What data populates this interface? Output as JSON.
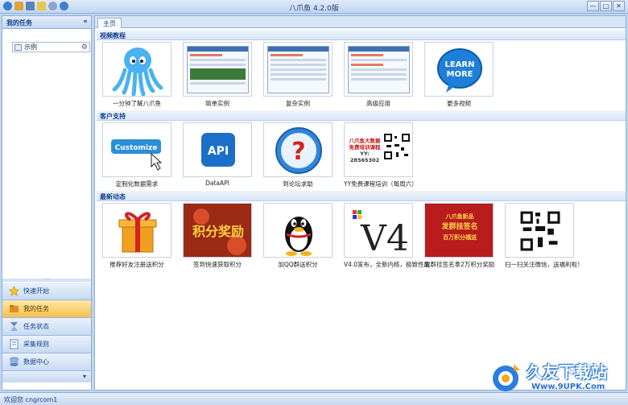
{
  "window": {
    "title": "八爪鱼 4.2.0版",
    "controls": [
      "—",
      "□",
      "✕"
    ]
  },
  "sidebar": {
    "header": "我的任务",
    "collapse": "«",
    "task": {
      "label": "示例"
    },
    "nav": [
      {
        "label": "快速开始",
        "icon": "star-icon",
        "color": "#f0c02a"
      },
      {
        "label": "我的任务",
        "icon": "folder-icon",
        "color": "#e38b1c"
      },
      {
        "label": "任务状态",
        "icon": "hourglass-icon",
        "color": "#5c8cc9"
      },
      {
        "label": "采集规则",
        "icon": "document-icon",
        "color": "#5c8cc9"
      },
      {
        "label": "数据中心",
        "icon": "database-icon",
        "color": "#5c8cc9"
      }
    ],
    "footer_arrow": "▾"
  },
  "main": {
    "tab": "主页",
    "sections": [
      {
        "title": "视频教程",
        "items": [
          {
            "caption": "一分钟了解八爪鱼",
            "icon": "octopus-icon"
          },
          {
            "caption": "简单实例",
            "icon": "webpage-icon"
          },
          {
            "caption": "复杂实例",
            "icon": "webpage-icon"
          },
          {
            "caption": "高级应用",
            "icon": "webpage-icon"
          },
          {
            "caption": "更多视频",
            "icon": "learn-more-icon",
            "badge": "LEARN\nMORE"
          }
        ]
      },
      {
        "title": "客户支持",
        "items": [
          {
            "caption": "定制化数据需求",
            "icon": "customize-icon",
            "badge": "Customize"
          },
          {
            "caption": "DataAPI",
            "icon": "api-icon",
            "badge": "API"
          },
          {
            "caption": "到论坛求助",
            "icon": "question-icon"
          },
          {
            "caption": "YY免费课程培训（每周六）",
            "icon": "qrcode-icon",
            "lines": [
              "八爪鱼大数据",
              "免费培训课程",
              "YY: 28565302"
            ]
          }
        ]
      },
      {
        "title": "最新动态",
        "items": [
          {
            "caption": "推荐好友注册送积分",
            "icon": "gift-icon"
          },
          {
            "caption": "签到快速获取积分",
            "icon": "points-icon",
            "badge": "积分奖励"
          },
          {
            "caption": "加QQ群送积分",
            "icon": "qq-penguin-icon"
          },
          {
            "caption": "V4.0发布，全新内核，极致性能",
            "icon": "v4-icon",
            "badge": "V4"
          },
          {
            "caption": "发群挂签名拿2万积分奖励",
            "icon": "banner-icon",
            "lines": [
              "八爪鱼新品",
              "发群挂签名",
              "百万积分福送"
            ]
          },
          {
            "caption": "扫一扫关注微信，送福利啦！",
            "icon": "qrcode-icon"
          }
        ]
      }
    ]
  },
  "status": {
    "text": "欢迎您 cngrcom1"
  },
  "watermark": {
    "main": "久友下载站",
    "sub": "Www.9UPK.Com"
  }
}
